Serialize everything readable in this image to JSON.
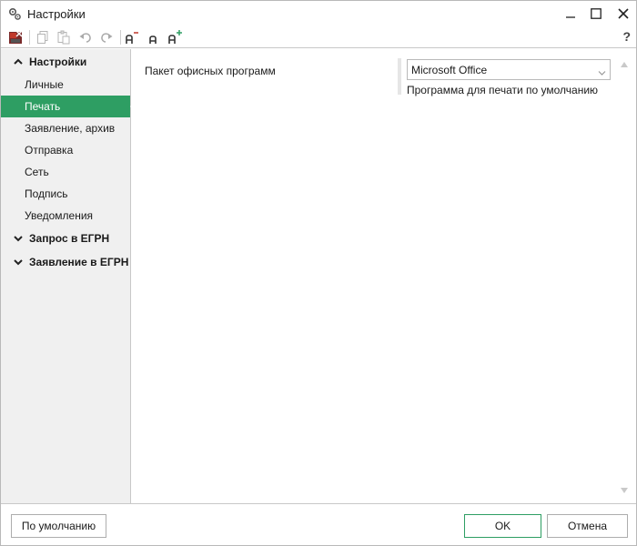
{
  "window": {
    "title": "Настройки",
    "icon": "gears-icon",
    "controls": [
      "minimize-icon",
      "maximize-icon",
      "close-icon"
    ]
  },
  "toolbar": {
    "icons": [
      "exit-doc-icon",
      "copy-icon",
      "paste-icon",
      "undo-icon",
      "redo-icon",
      "font-decrease-icon",
      "font-default-icon",
      "font-increase-icon"
    ],
    "help_label": "?"
  },
  "sidebar": {
    "groups": [
      {
        "label": "Настройки",
        "expanded": true,
        "items": [
          {
            "label": "Личные",
            "active": false
          },
          {
            "label": "Печать",
            "active": true
          },
          {
            "label": "Заявление, архив",
            "active": false
          },
          {
            "label": "Отправка",
            "active": false
          },
          {
            "label": "Сеть",
            "active": false
          },
          {
            "label": "Подпись",
            "active": false
          },
          {
            "label": "Уведомления",
            "active": false
          }
        ]
      },
      {
        "label": "Запрос в ЕГРН",
        "expanded": false
      },
      {
        "label": "Заявление в ЕГРН",
        "expanded": false
      }
    ],
    "active_color": "#2e9e63"
  },
  "content": {
    "field_label": "Пакет офисных программ",
    "select_value": "Microsoft Office",
    "hint": "Программа для печати по умолчанию"
  },
  "footer": {
    "default_label": "По умолчанию",
    "ok_label": "OK",
    "cancel_label": "Отмена"
  }
}
